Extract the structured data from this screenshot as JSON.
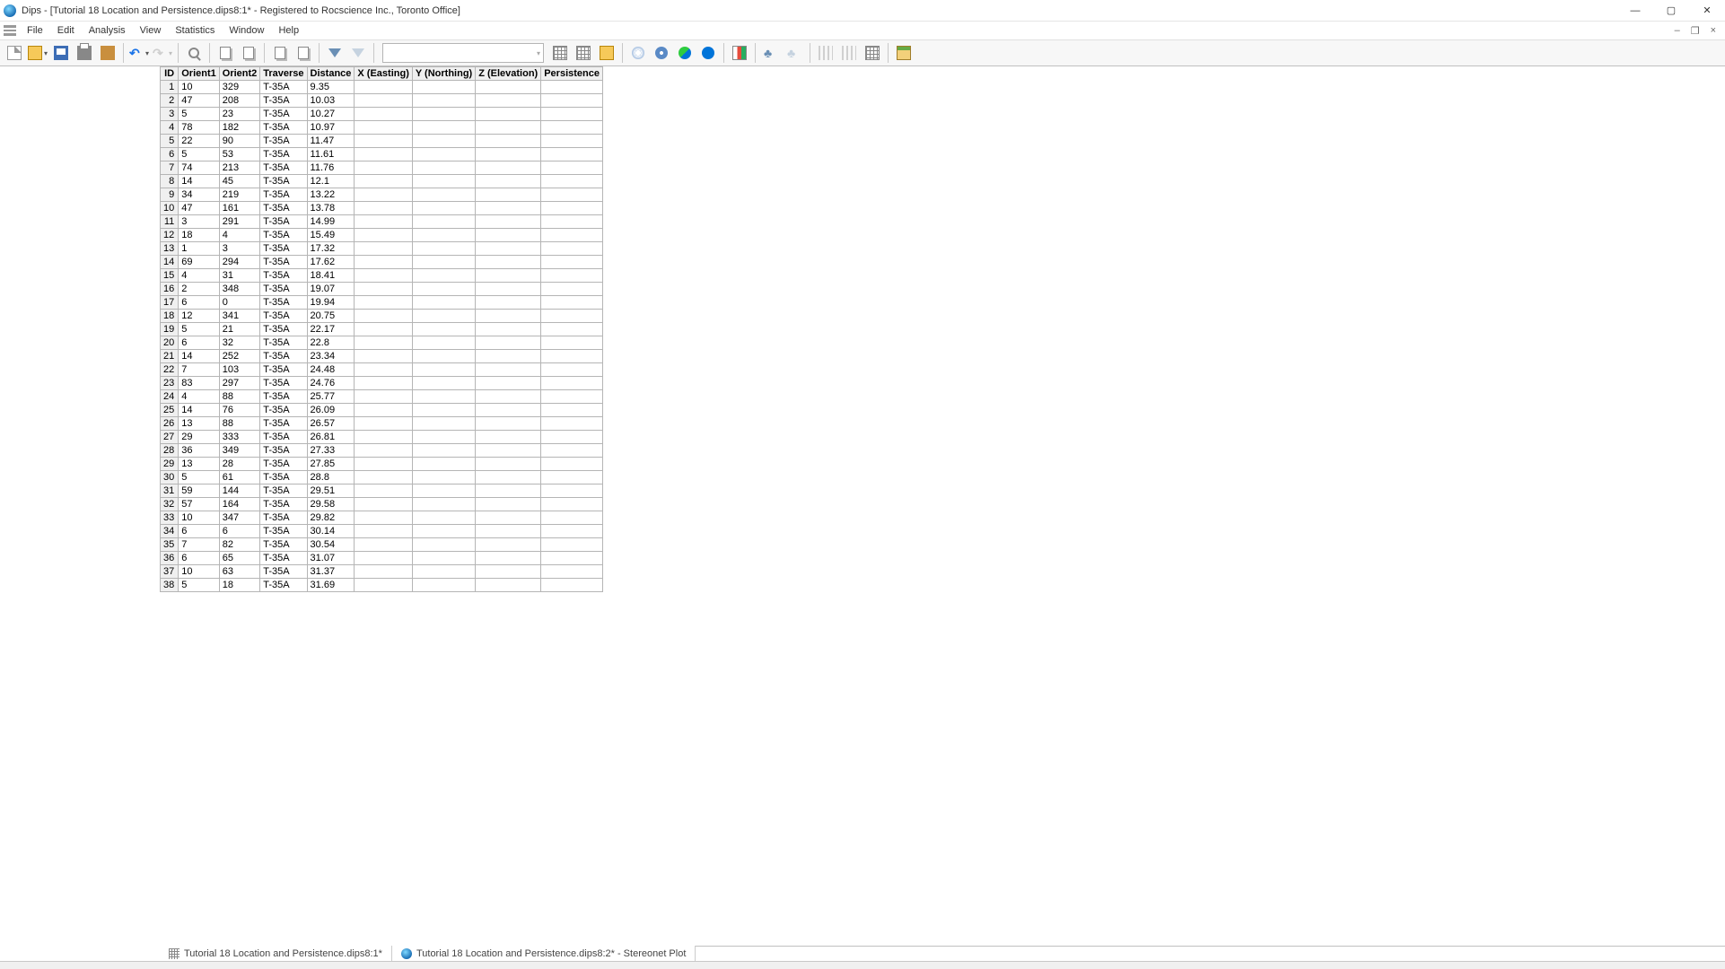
{
  "title": "Dips - [Tutorial 18 Location and Persistence.dips8:1* - Registered to Rocscience Inc., Toronto Office]",
  "menu": {
    "items": [
      "File",
      "Edit",
      "Analysis",
      "View",
      "Statistics",
      "Window",
      "Help"
    ]
  },
  "tabs": {
    "active": "Tutorial 18 Location and Persistence.dips8:1*",
    "second": "Tutorial 18 Location and Persistence.dips8:2* - Stereonet Plot"
  },
  "table": {
    "headers": [
      "ID",
      "Orient1",
      "Orient2",
      "Traverse",
      "Distance",
      "X (Easting)",
      "Y (Northing)",
      "Z (Elevation)",
      "Persistence"
    ],
    "rows": [
      {
        "id": "1",
        "o1": "10",
        "o2": "329",
        "tr": "T-35A",
        "di": "9.35"
      },
      {
        "id": "2",
        "o1": "47",
        "o2": "208",
        "tr": "T-35A",
        "di": "10.03"
      },
      {
        "id": "3",
        "o1": "5",
        "o2": "23",
        "tr": "T-35A",
        "di": "10.27"
      },
      {
        "id": "4",
        "o1": "78",
        "o2": "182",
        "tr": "T-35A",
        "di": "10.97"
      },
      {
        "id": "5",
        "o1": "22",
        "o2": "90",
        "tr": "T-35A",
        "di": "11.47"
      },
      {
        "id": "6",
        "o1": "5",
        "o2": "53",
        "tr": "T-35A",
        "di": "11.61"
      },
      {
        "id": "7",
        "o1": "74",
        "o2": "213",
        "tr": "T-35A",
        "di": "11.76"
      },
      {
        "id": "8",
        "o1": "14",
        "o2": "45",
        "tr": "T-35A",
        "di": "12.1"
      },
      {
        "id": "9",
        "o1": "34",
        "o2": "219",
        "tr": "T-35A",
        "di": "13.22"
      },
      {
        "id": "10",
        "o1": "47",
        "o2": "161",
        "tr": "T-35A",
        "di": "13.78"
      },
      {
        "id": "11",
        "o1": "3",
        "o2": "291",
        "tr": "T-35A",
        "di": "14.99"
      },
      {
        "id": "12",
        "o1": "18",
        "o2": "4",
        "tr": "T-35A",
        "di": "15.49"
      },
      {
        "id": "13",
        "o1": "1",
        "o2": "3",
        "tr": "T-35A",
        "di": "17.32"
      },
      {
        "id": "14",
        "o1": "69",
        "o2": "294",
        "tr": "T-35A",
        "di": "17.62"
      },
      {
        "id": "15",
        "o1": "4",
        "o2": "31",
        "tr": "T-35A",
        "di": "18.41"
      },
      {
        "id": "16",
        "o1": "2",
        "o2": "348",
        "tr": "T-35A",
        "di": "19.07"
      },
      {
        "id": "17",
        "o1": "6",
        "o2": "0",
        "tr": "T-35A",
        "di": "19.94"
      },
      {
        "id": "18",
        "o1": "12",
        "o2": "341",
        "tr": "T-35A",
        "di": "20.75"
      },
      {
        "id": "19",
        "o1": "5",
        "o2": "21",
        "tr": "T-35A",
        "di": "22.17"
      },
      {
        "id": "20",
        "o1": "6",
        "o2": "32",
        "tr": "T-35A",
        "di": "22.8"
      },
      {
        "id": "21",
        "o1": "14",
        "o2": "252",
        "tr": "T-35A",
        "di": "23.34"
      },
      {
        "id": "22",
        "o1": "7",
        "o2": "103",
        "tr": "T-35A",
        "di": "24.48"
      },
      {
        "id": "23",
        "o1": "83",
        "o2": "297",
        "tr": "T-35A",
        "di": "24.76"
      },
      {
        "id": "24",
        "o1": "4",
        "o2": "88",
        "tr": "T-35A",
        "di": "25.77",
        "mark": true
      },
      {
        "id": "25",
        "o1": "14",
        "o2": "76",
        "tr": "T-35A",
        "di": "26.09"
      },
      {
        "id": "26",
        "o1": "13",
        "o2": "88",
        "tr": "T-35A",
        "di": "26.57"
      },
      {
        "id": "27",
        "o1": "29",
        "o2": "333",
        "tr": "T-35A",
        "di": "26.81",
        "mark": true
      },
      {
        "id": "28",
        "o1": "36",
        "o2": "349",
        "tr": "T-35A",
        "di": "27.33"
      },
      {
        "id": "29",
        "o1": "13",
        "o2": "28",
        "tr": "T-35A",
        "di": "27.85"
      },
      {
        "id": "30",
        "o1": "5",
        "o2": "61",
        "tr": "T-35A",
        "di": "28.8"
      },
      {
        "id": "31",
        "o1": "59",
        "o2": "144",
        "tr": "T-35A",
        "di": "29.51",
        "mark": true
      },
      {
        "id": "32",
        "o1": "57",
        "o2": "164",
        "tr": "T-35A",
        "di": "29.58"
      },
      {
        "id": "33",
        "o1": "10",
        "o2": "347",
        "tr": "T-35A",
        "di": "29.82"
      },
      {
        "id": "34",
        "o1": "6",
        "o2": "6",
        "tr": "T-35A",
        "di": "30.14"
      },
      {
        "id": "35",
        "o1": "7",
        "o2": "82",
        "tr": "T-35A",
        "di": "30.54"
      },
      {
        "id": "36",
        "o1": "6",
        "o2": "65",
        "tr": "T-35A",
        "di": "31.07"
      },
      {
        "id": "37",
        "o1": "10",
        "o2": "63",
        "tr": "T-35A",
        "di": "31.37"
      },
      {
        "id": "38",
        "o1": "5",
        "o2": "18",
        "tr": "T-35A",
        "di": "31.69"
      }
    ]
  }
}
